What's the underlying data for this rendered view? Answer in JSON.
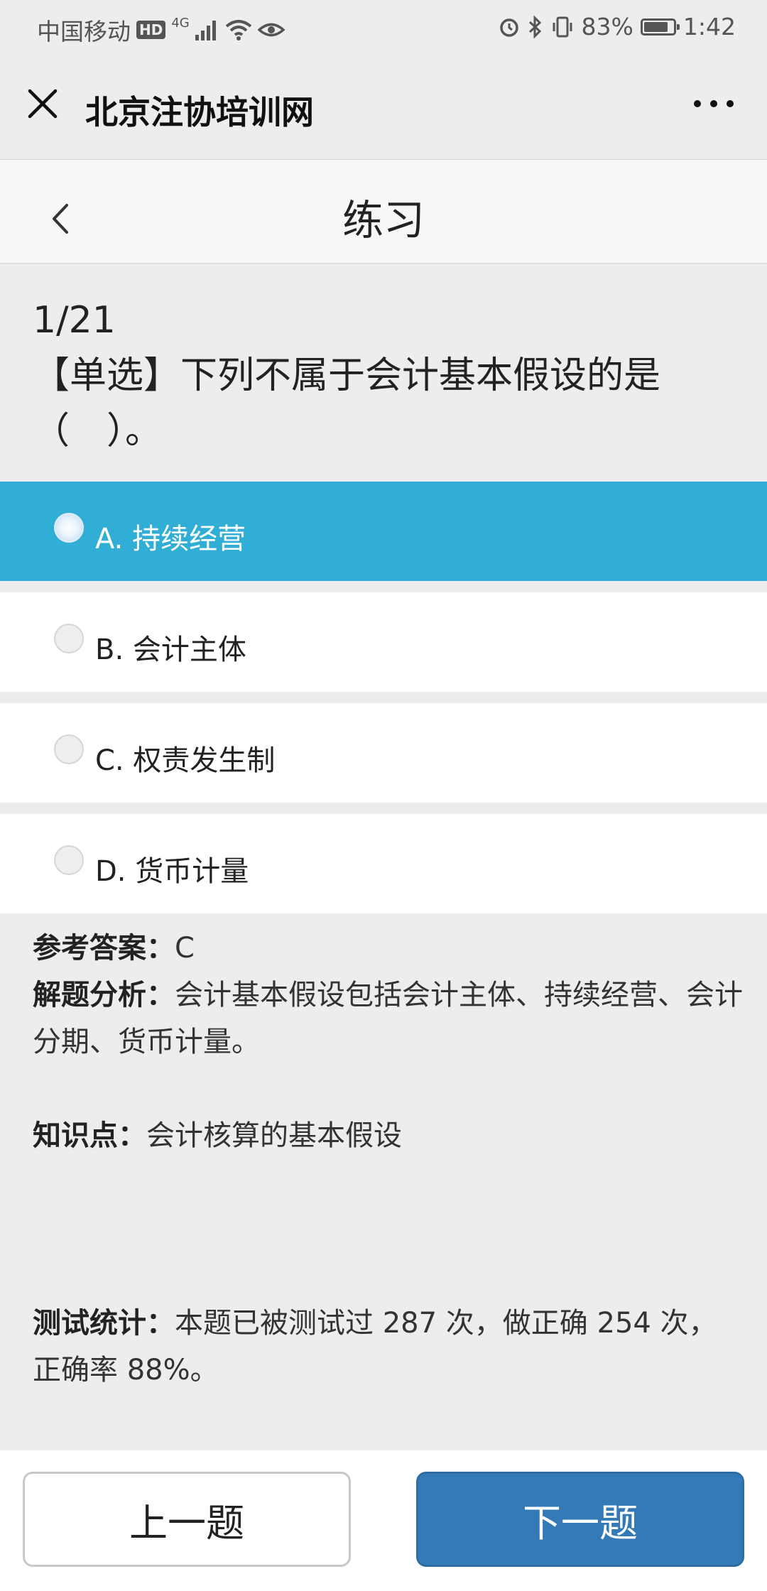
{
  "status_bar": {
    "carrier": "中国移动",
    "hd": "HD",
    "network": "4G",
    "battery_percent": "83%",
    "battery_level": 0.83,
    "time": "1:42"
  },
  "wechat_bar": {
    "title": "北京注协培训网"
  },
  "page": {
    "title": "练习"
  },
  "question": {
    "counter": "1/21",
    "text": "【单选】下列不属于会计基本假设的是（　）。"
  },
  "options": [
    {
      "label": "A. 持续经营",
      "selected": true
    },
    {
      "label": "B. 会计主体",
      "selected": false
    },
    {
      "label": "C. 权责发生制",
      "selected": false
    },
    {
      "label": "D. 货币计量",
      "selected": false
    }
  ],
  "analysis": {
    "answer_label": "参考答案：",
    "answer_value": "C",
    "explain_label": "解题分析：",
    "explain_text": "会计基本假设包括会计主体、持续经营、会计分期、货币计量。",
    "knowledge_label": "知识点：",
    "knowledge_text": "会计核算的基本假设",
    "stats_label": "测试统计：",
    "stats_text": "本题已被测试过 287 次，做正确 254 次，正确率 88%。"
  },
  "footer": {
    "prev_label": "上一题",
    "next_label": "下一题"
  },
  "colors": {
    "selected_option": "#31aed6",
    "next_button": "#337ab7"
  }
}
